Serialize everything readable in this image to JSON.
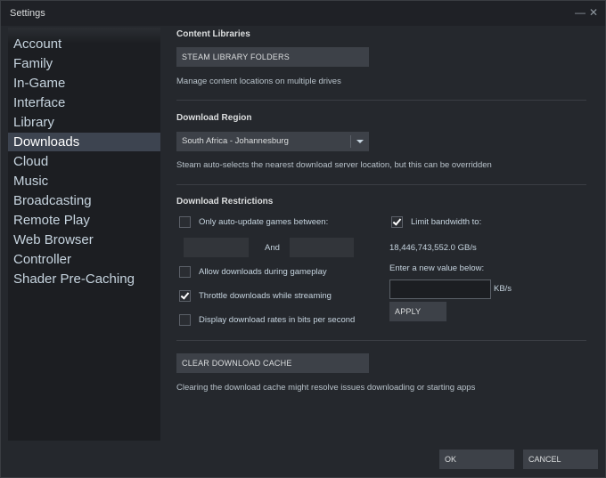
{
  "window": {
    "title": "Settings",
    "minimize_glyph": "—",
    "close_glyph": "✕"
  },
  "sidebar": {
    "items": [
      {
        "label": "Account"
      },
      {
        "label": "Family"
      },
      {
        "label": "In-Game"
      },
      {
        "label": "Interface"
      },
      {
        "label": "Library"
      },
      {
        "label": "Downloads"
      },
      {
        "label": "Cloud"
      },
      {
        "label": "Music"
      },
      {
        "label": "Broadcasting"
      },
      {
        "label": "Remote Play"
      },
      {
        "label": "Web Browser"
      },
      {
        "label": "Controller"
      },
      {
        "label": "Shader Pre-Caching"
      }
    ],
    "active": "Downloads"
  },
  "content_libraries": {
    "title": "Content Libraries",
    "button": "STEAM LIBRARY FOLDERS",
    "description": "Manage content locations on multiple drives"
  },
  "download_region": {
    "title": "Download Region",
    "selected": "South Africa - Johannesburg",
    "description": "Steam auto-selects the nearest download server location, but this can be overridden"
  },
  "download_restrictions": {
    "title": "Download Restrictions",
    "auto_update": {
      "label": "Only auto-update games between:",
      "checked": false
    },
    "and_label": "And",
    "allow_gameplay": {
      "label": "Allow downloads during gameplay",
      "checked": false
    },
    "throttle": {
      "label": "Throttle downloads while streaming",
      "checked": true
    },
    "bits": {
      "label": "Display download rates in bits per second",
      "checked": false
    },
    "limit_bandwidth": {
      "label": "Limit bandwidth to:",
      "checked": true
    },
    "bandwidth_value": "18,446,743,552.0 GB/s",
    "enter_prompt": "Enter a new value below:",
    "bandwidth_input": "",
    "unit": "KB/s",
    "apply_button": "APPLY"
  },
  "cache": {
    "button": "CLEAR DOWNLOAD CACHE",
    "description": "Clearing the download cache might resolve issues downloading or starting apps"
  },
  "footer": {
    "ok": "OK",
    "cancel": "CANCEL"
  },
  "colors": {
    "background": "#25282d",
    "sidebar": "#1c1e22",
    "active_item": "#3d4450",
    "button": "#3d4148"
  },
  "icons": {
    "minimize": "minimize-icon",
    "close": "close-icon",
    "dropdown": "chevron-down-icon",
    "check": "checkmark-icon"
  }
}
